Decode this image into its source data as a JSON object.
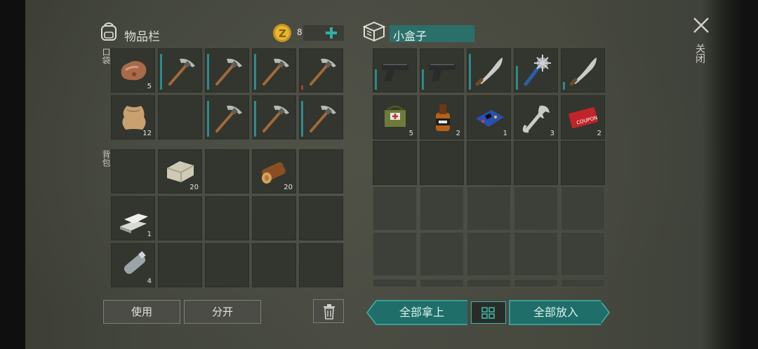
{
  "colors": {
    "accent": "#2e8b8b",
    "gold": "#d8a928",
    "teal": "#1f6e6a",
    "plus": "#2fb0a4"
  },
  "left_panel": {
    "title": "物品栏",
    "icon": "backpack-icon",
    "coins": "8",
    "coin_icon": "coin-icon",
    "plus_icon": "plus-icon",
    "pocket_label": "口袋",
    "backpack_label": "背包"
  },
  "right_panel": {
    "title": "小盒子",
    "icon": "box-icon"
  },
  "close": {
    "icon": "close-icon",
    "label": "关闭"
  },
  "buttons": {
    "use": "使用",
    "split": "分开",
    "trash_icon": "trash-icon",
    "take_all": "全部拿上",
    "grid_icon": "grid-icon",
    "put_all": "全部放入"
  },
  "pocket_items": [
    {
      "name": "stone",
      "count": "5"
    },
    {
      "name": "pickaxe",
      "durability": 0.9
    },
    {
      "name": "pickaxe",
      "durability": 0.9
    },
    {
      "name": "pickaxe",
      "durability": 0.9
    },
    {
      "name": "pickaxe",
      "durability": 0.1,
      "durability_color": "red"
    },
    {
      "name": "leather",
      "count": "12"
    },
    {
      "name": "empty"
    },
    {
      "name": "pickaxe",
      "durability": 0.9
    },
    {
      "name": "pickaxe",
      "durability": 0.9
    },
    {
      "name": "pickaxe",
      "durability": 0.9
    }
  ],
  "backpack_items": [
    {
      "name": "empty"
    },
    {
      "name": "stone-block",
      "count": "20"
    },
    {
      "name": "empty"
    },
    {
      "name": "log",
      "count": "20"
    },
    {
      "name": "empty"
    },
    {
      "name": "iron-bars",
      "count": "1"
    },
    {
      "name": "empty"
    },
    {
      "name": "empty"
    },
    {
      "name": "empty"
    },
    {
      "name": "empty"
    },
    {
      "name": "water-bottle",
      "count": "4"
    },
    {
      "name": "empty"
    },
    {
      "name": "empty"
    },
    {
      "name": "empty"
    },
    {
      "name": "empty"
    }
  ],
  "box_items": [
    {
      "name": "pistol",
      "durability": 0.5
    },
    {
      "name": "pistol",
      "durability": 0.5
    },
    {
      "name": "machete",
      "durability": 0.9
    },
    {
      "name": "spiked-club",
      "durability": 0.6
    },
    {
      "name": "machete",
      "durability": 0.2
    },
    {
      "name": "first-aid-bag",
      "count": "5"
    },
    {
      "name": "whiskey-bottle",
      "count": "2"
    },
    {
      "name": "circuit-board",
      "count": "1"
    },
    {
      "name": "wrench",
      "count": "3"
    },
    {
      "name": "combat-coupon",
      "count": "2"
    }
  ]
}
